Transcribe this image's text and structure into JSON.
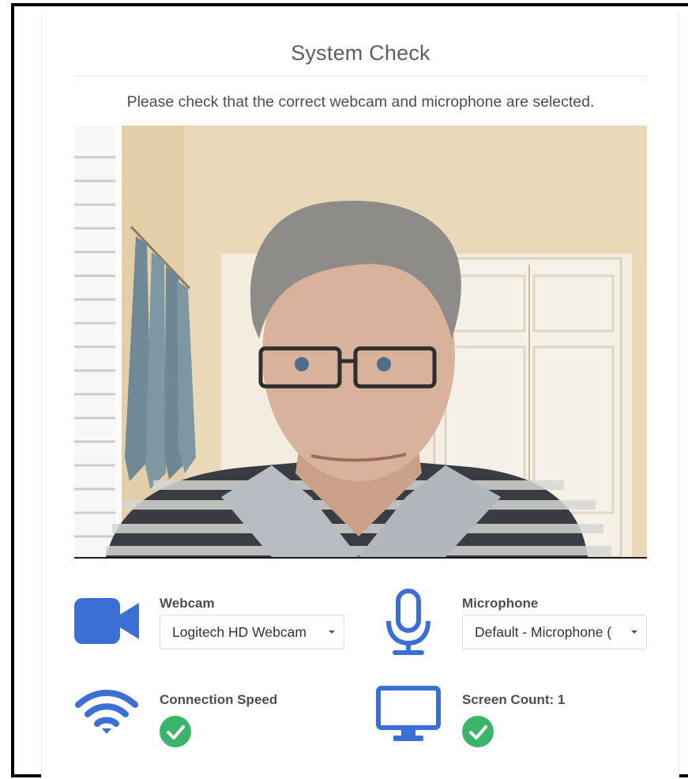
{
  "page": {
    "title": "System Check",
    "instruction": "Please check that the correct webcam and microphone are selected."
  },
  "webcam": {
    "label": "Webcam",
    "selected": "Logitech HD Webcam",
    "icon": "video-camera-icon"
  },
  "microphone": {
    "label": "Microphone",
    "selected": "Default - Microphone (",
    "icon": "microphone-icon"
  },
  "connection": {
    "label": "Connection Speed",
    "icon": "wifi-icon",
    "status": "ok"
  },
  "screen": {
    "label": "Screen Count: 1",
    "icon": "monitor-icon",
    "status": "ok"
  },
  "colors": {
    "accent": "#3b6fd6",
    "success": "#3bb56b",
    "text": "#4a4f55"
  }
}
